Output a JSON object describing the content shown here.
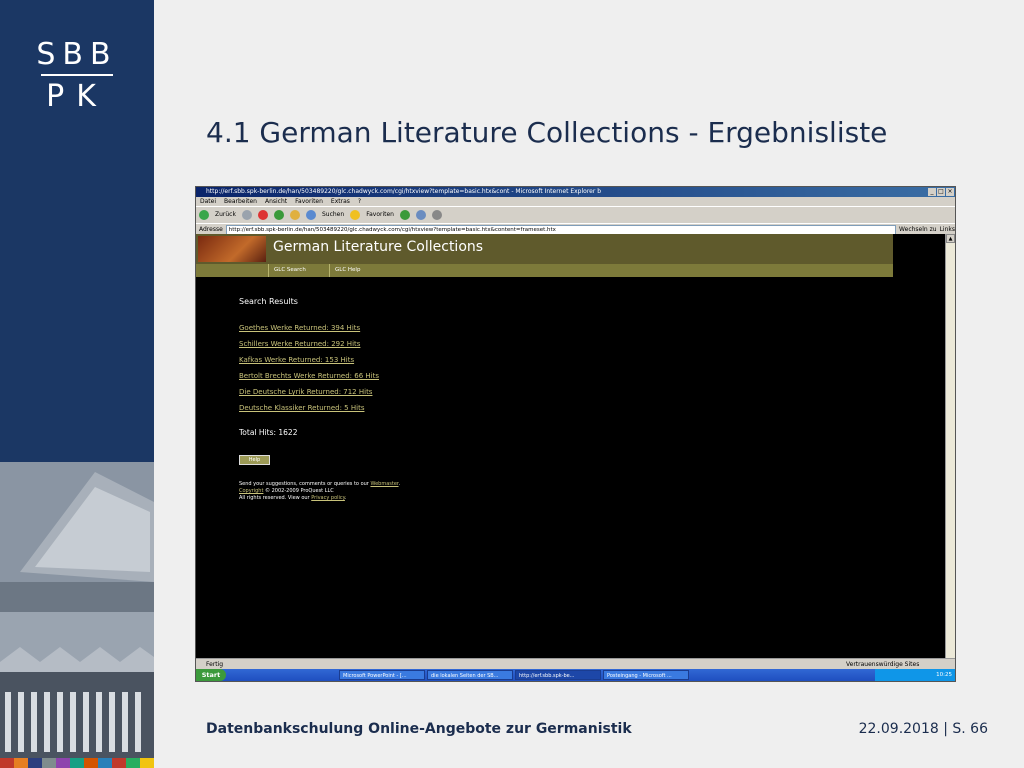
{
  "brand": {
    "line1": "SBB",
    "line2": "PK"
  },
  "slide": {
    "title": "4.1 German Literature Collections - Ergebnisliste",
    "footer_left": "Datenbankschulung Online-Angebote zur Germanistik",
    "footer_right": "22.09.2018 | S. 66"
  },
  "browser": {
    "window_title": "http://erf.sbb.spk-berlin.de/han/503489220/glc.chadwyck.com/cgi/htxview?template=basic.htx&cont - Microsoft Internet Explorer b",
    "menu": [
      "Datei",
      "Bearbeiten",
      "Ansicht",
      "Favoriten",
      "Extras",
      "?"
    ],
    "toolbar": {
      "back": "Zurück",
      "search": "Suchen",
      "favorites": "Favoriten"
    },
    "address_label": "Adresse",
    "address": "http://erf.sbb.spk-berlin.de/han/503489220/glc.chadwyck.com/cgi/htxview?template=basic.htx&content=frameset.htx",
    "go": "Wechseln zu",
    "links": "Links",
    "status_left": "Fertig",
    "status_right": "Vertrauenswürdige Sites"
  },
  "page": {
    "header_title": "German Literature Collections",
    "nav": [
      "GLC Search",
      "GLC Help"
    ],
    "results_heading": "Search Results",
    "results": [
      "Goethes Werke Returned: 394 Hits",
      "Schillers Werke Returned: 292 Hits",
      "Kafkas Werke Returned: 153 Hits",
      "Bertolt Brechts Werke Returned: 66 Hits",
      "Die Deutsche Lyrik Returned: 712 Hits",
      "Deutsche Klassiker Returned: 5 Hits"
    ],
    "total": "Total Hits: 1622",
    "help_button": "Help",
    "fine_1_prefix": "Send your suggestions, comments or queries to our ",
    "fine_1_link": "Webmaster",
    "fine_1_suffix": ".",
    "fine_2_link": "Copyright",
    "fine_2_text": " © 2002-2009 ProQuest LLC",
    "fine_3_prefix": "All rights reserved. View our ",
    "fine_3_link": "Privacy policy",
    "fine_3_suffix": "."
  },
  "taskbar": {
    "start": "Start",
    "items": [
      "Microsoft PowerPoint - [...",
      "die lokalen Seiten der SB...",
      "http://erf.sbb.spk-be...",
      "Posteingang - Microsoft ..."
    ],
    "clock": "10:25"
  },
  "colors": {
    "sidebar": "#1b3764",
    "header_olive": "#5f5a2c",
    "link": "#c8c27a"
  }
}
